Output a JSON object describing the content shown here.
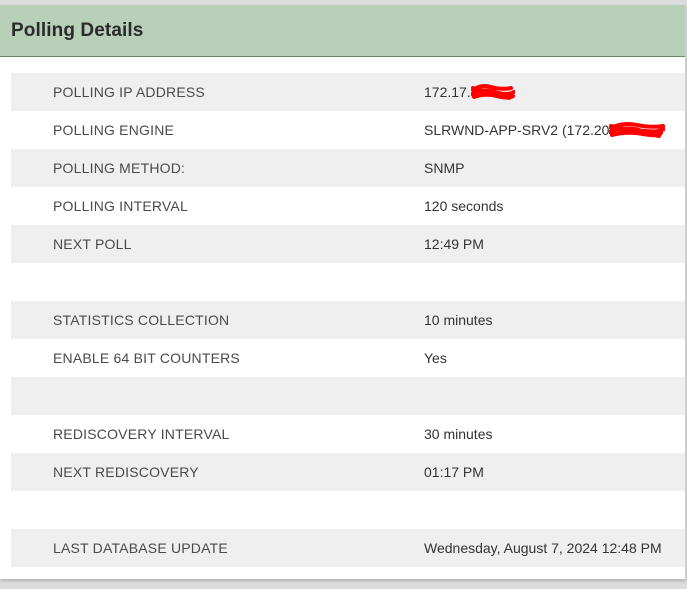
{
  "panel": {
    "title": "Polling Details"
  },
  "colors": {
    "header_bg": "#b8cfb8",
    "header_border": "#5f8f5f",
    "row_shaded": "#efefef",
    "redaction": "#ff0000"
  },
  "rows": [
    {
      "label": "POLLING IP ADDRESS",
      "value": "172.17.",
      "redacted": true
    },
    {
      "label": "POLLING ENGINE",
      "value": "SLRWND-APP-SRV2 (172.20",
      "redacted": true
    },
    {
      "label": "POLLING METHOD:",
      "value": "SNMP"
    },
    {
      "label": "POLLING INTERVAL",
      "value": "120 seconds"
    },
    {
      "label": "NEXT POLL",
      "value": "12:49 PM"
    },
    {
      "label": "",
      "value": ""
    },
    {
      "label": "STATISTICS COLLECTION",
      "value": "10 minutes"
    },
    {
      "label": "ENABLE 64 BIT COUNTERS",
      "value": "Yes"
    },
    {
      "label": "",
      "value": ""
    },
    {
      "label": "REDISCOVERY INTERVAL",
      "value": "30 minutes"
    },
    {
      "label": "NEXT REDISCOVERY",
      "value": "01:17 PM"
    },
    {
      "label": "",
      "value": ""
    },
    {
      "label": "LAST DATABASE UPDATE",
      "value": "Wednesday, August 7, 2024 12:48 PM"
    }
  ]
}
